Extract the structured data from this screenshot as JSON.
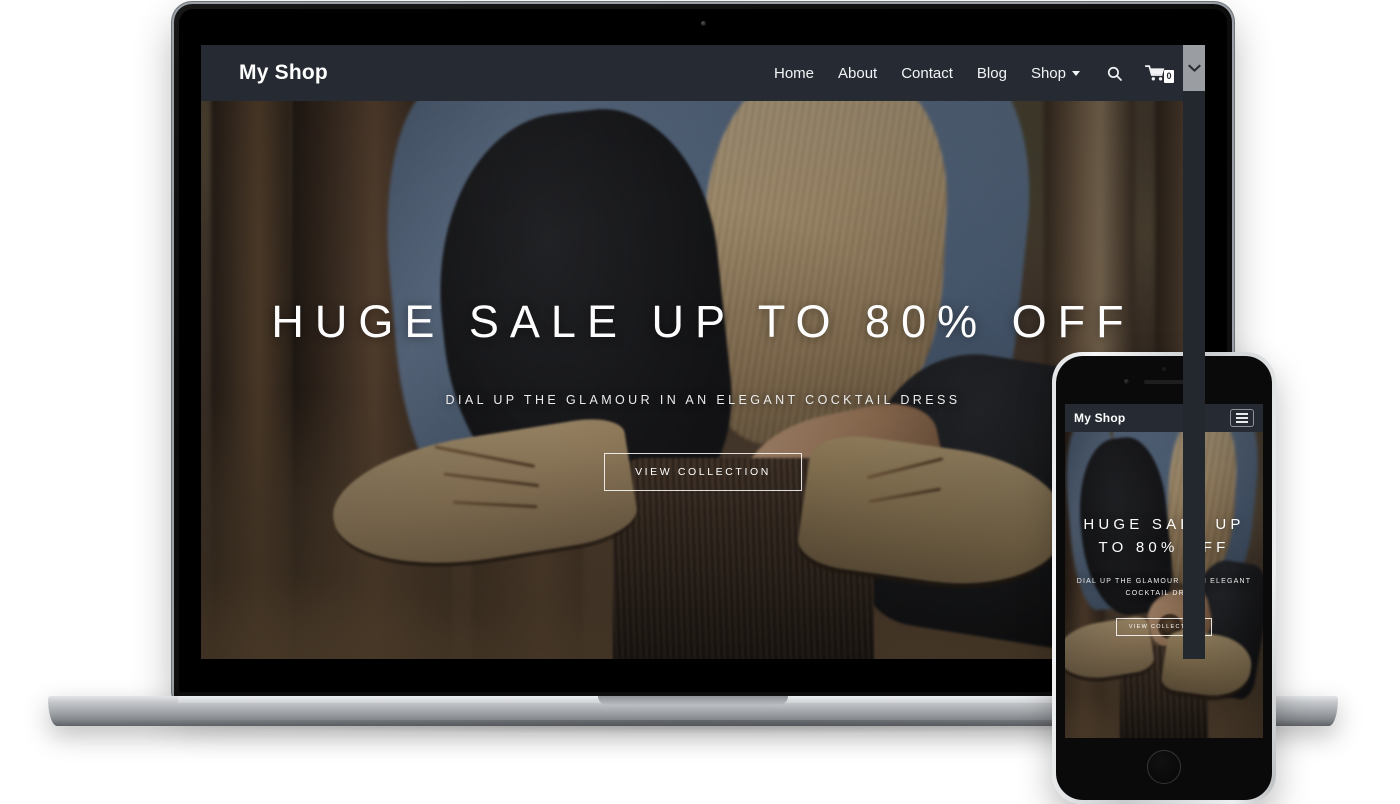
{
  "site": {
    "brand": "My Shop",
    "nav": [
      {
        "label": "Home"
      },
      {
        "label": "About"
      },
      {
        "label": "Contact"
      },
      {
        "label": "Blog"
      },
      {
        "label": "Shop",
        "has_dropdown": true
      }
    ],
    "search_icon": "search-icon",
    "cart_icon": "cart-icon",
    "cart_count": "0",
    "hero": {
      "title": "HUGE SALE UP TO 80% OFF",
      "subtitle": "DIAL UP THE GLAMOUR IN AN ELEGANT COCKTAIL DRESS",
      "cta": "VIEW COLLECTION"
    },
    "mobile": {
      "menu_icon": "hamburger-menu-icon"
    }
  },
  "colors": {
    "navbar_bg": "#262b33",
    "nav_text": "#f2f3f5",
    "hero_text": "#ffffff",
    "page_bg": "#ffffff",
    "scrollbar_thumb": "#9a9ea3",
    "scrollbar_track": "#23272e",
    "laptop_bezel": "#0b0b0b",
    "laptop_base": "#a3a7ab",
    "phone_body": "#c9ccce",
    "phone_face": "#0a0a0a"
  },
  "devices": {
    "laptop_label": "laptop-mockup",
    "phone_label": "phone-mockup"
  }
}
